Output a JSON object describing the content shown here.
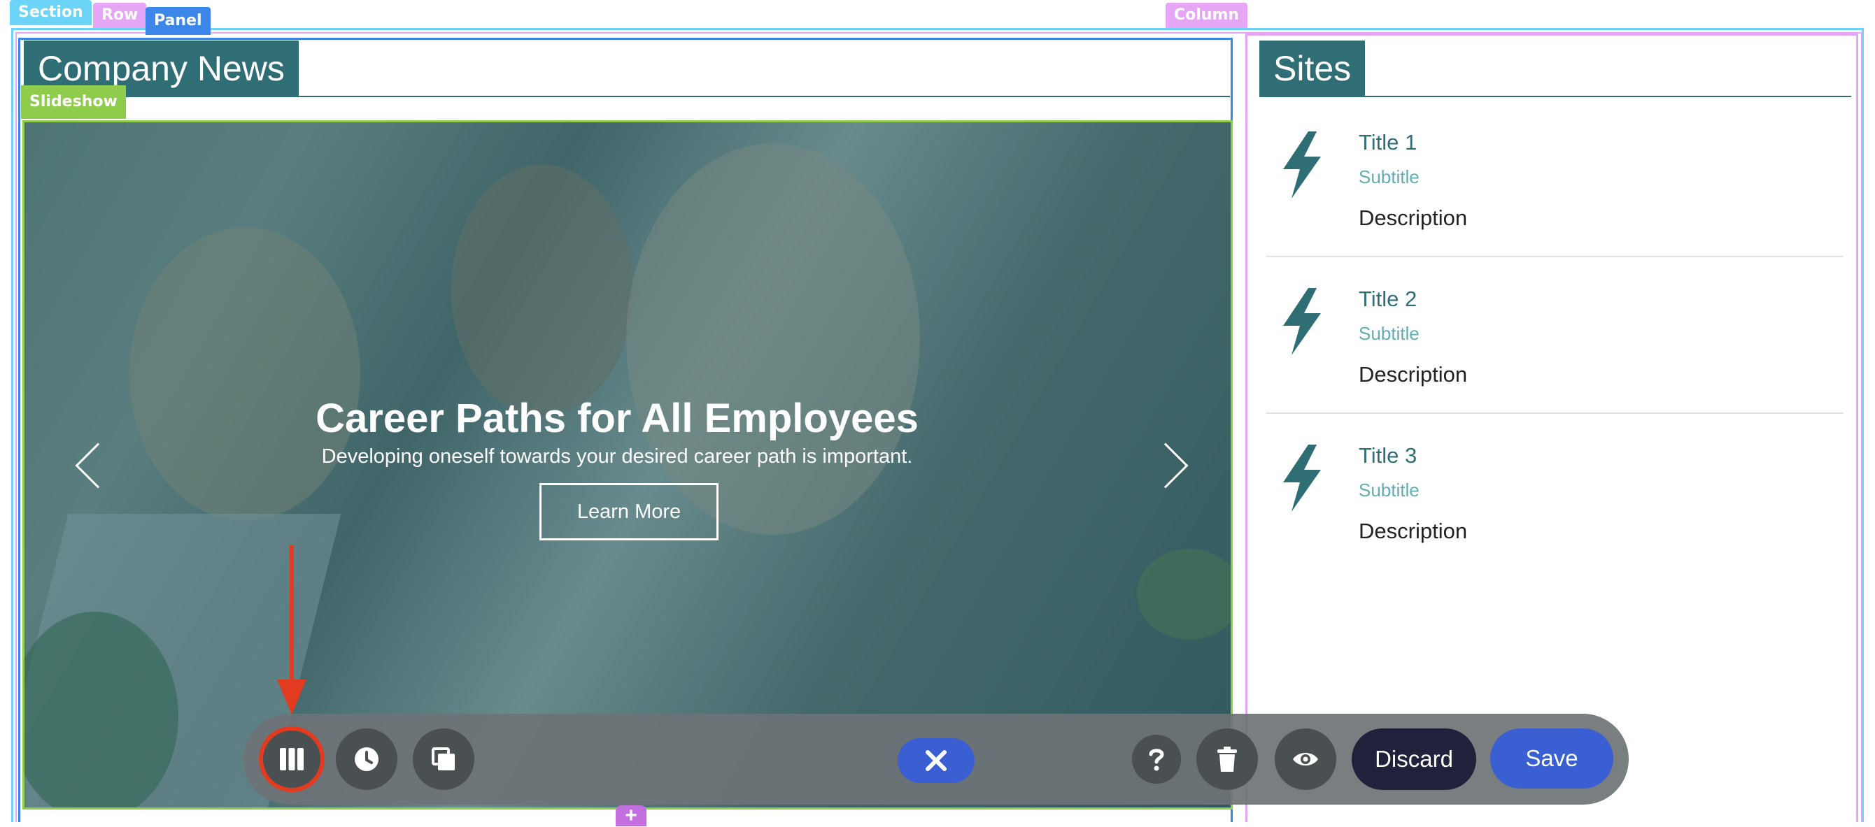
{
  "tags": {
    "section": "Section",
    "row": "Row",
    "panel": "Panel",
    "column": "Column",
    "slideshow": "Slideshow"
  },
  "news": {
    "title": "Company News",
    "slide": {
      "title": "Career Paths for All Employees",
      "subtitle": "Developing oneself towards your desired career path is important.",
      "button": "Learn More"
    }
  },
  "sites": {
    "title": "Sites",
    "items": [
      {
        "title": "Title 1",
        "subtitle": "Subtitle",
        "description": "Description"
      },
      {
        "title": "Title 2",
        "subtitle": "Subtitle",
        "description": "Description"
      },
      {
        "title": "Title 3",
        "subtitle": "Subtitle",
        "description": "Description"
      }
    ]
  },
  "toolbar": {
    "discard": "Discard",
    "save": "Save",
    "add": "+"
  },
  "icons": {
    "layout": "columns-icon",
    "history": "clock-icon",
    "copy": "copy-icon",
    "close": "close-icon",
    "help": "help-icon",
    "delete": "trash-icon",
    "preview": "eye-icon",
    "site": "lightning-bolt-icon"
  },
  "colors": {
    "teal": "#2f6e74",
    "subtitle": "#5eaeb2",
    "section": "#6cd4f7",
    "row": "#e7a6f5",
    "panel": "#3b86e8",
    "slideshow": "#8fcc4b",
    "close_pill": "#3a5fd3",
    "save_pill": "#3a5fd3",
    "discard_pill": "#20223b",
    "annotation": "#e23b1f"
  }
}
